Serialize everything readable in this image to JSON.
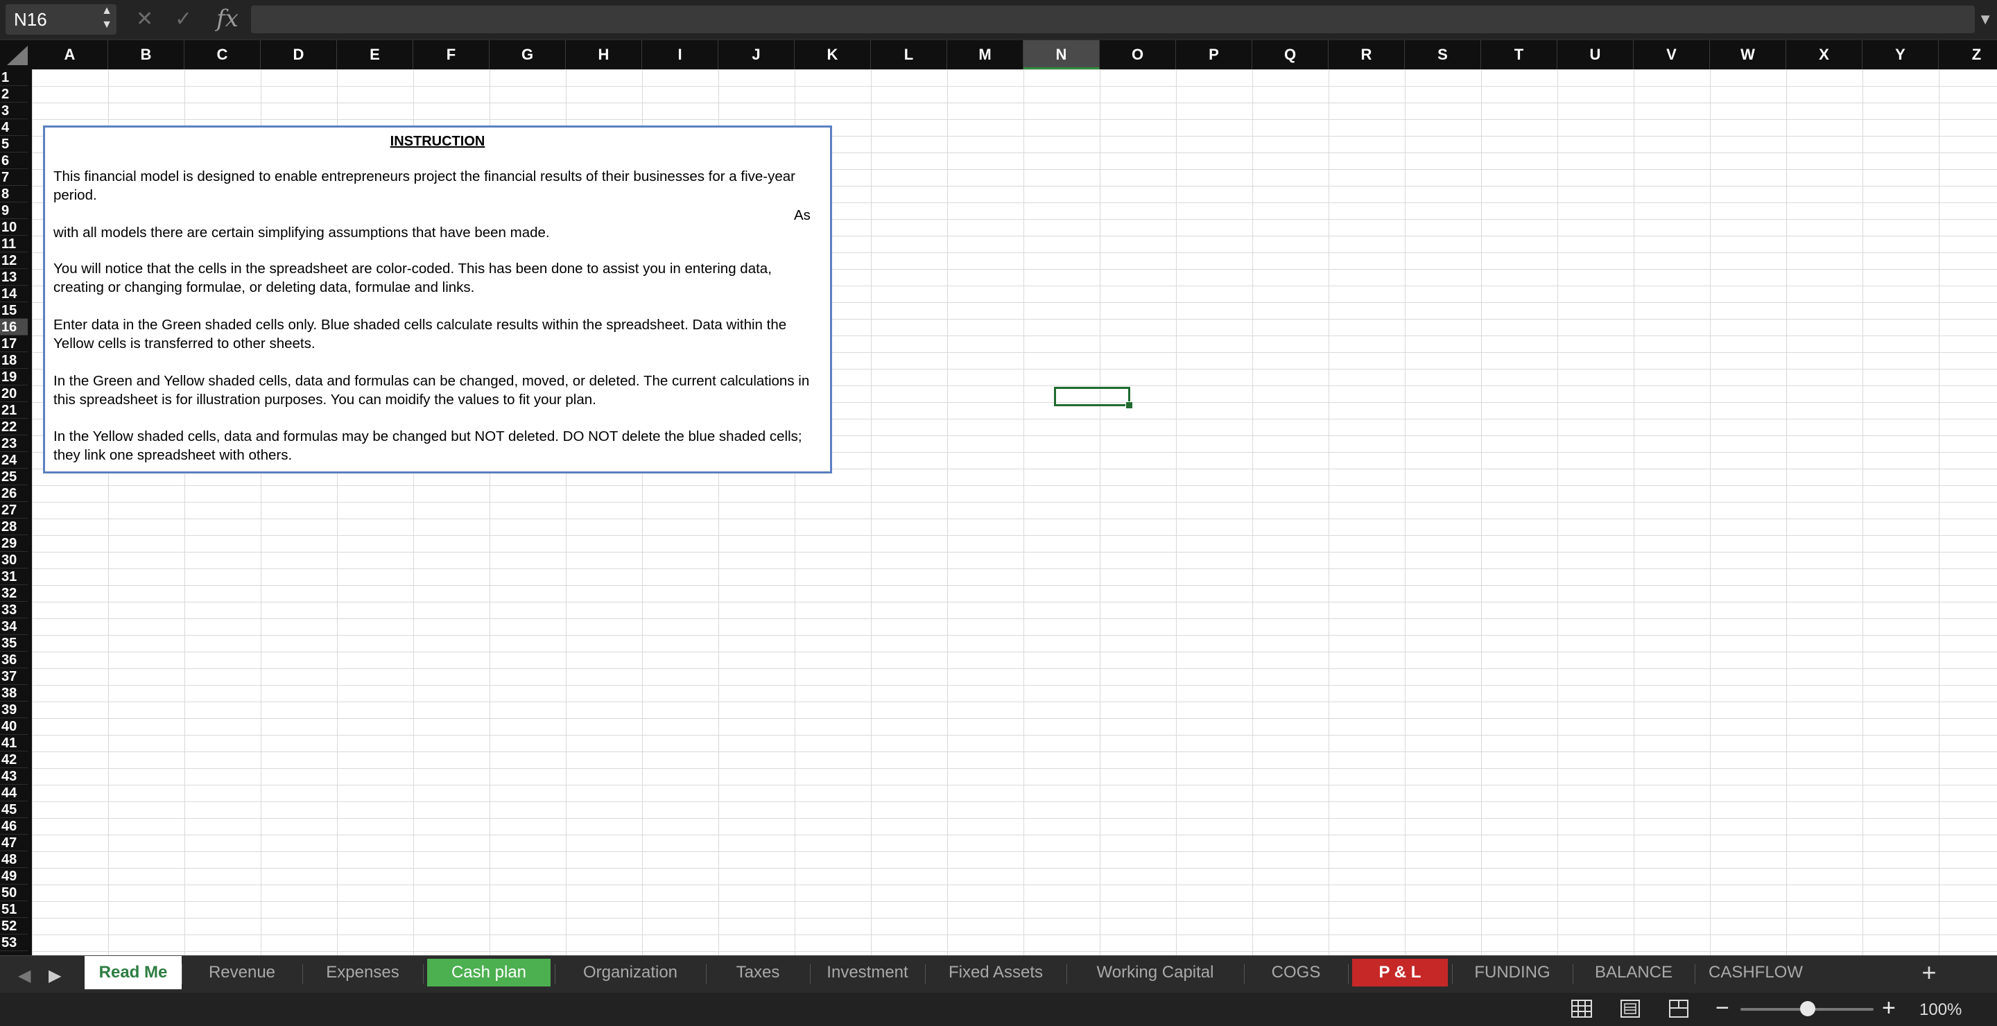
{
  "formula_bar": {
    "cell_ref": "N16",
    "fx_label": "fx",
    "cancel_icon": "x-icon",
    "confirm_icon": "check-icon",
    "formula_value": ""
  },
  "columns": [
    "A",
    "B",
    "C",
    "D",
    "E",
    "F",
    "G",
    "H",
    "I",
    "J",
    "K",
    "L",
    "M",
    "N",
    "O",
    "P",
    "Q",
    "R",
    "S",
    "T",
    "U",
    "V",
    "W",
    "X",
    "Y",
    "Z"
  ],
  "selected_column": "N",
  "rows": [
    "1",
    "2",
    "3",
    "4",
    "5",
    "6",
    "7",
    "8",
    "9",
    "10",
    "11",
    "12",
    "13",
    "14",
    "15",
    "16",
    "17",
    "18",
    "19",
    "20",
    "21",
    "22",
    "23",
    "24",
    "25",
    "26",
    "27",
    "28",
    "29",
    "30",
    "31",
    "32",
    "33",
    "34",
    "35",
    "36",
    "37",
    "38",
    "39",
    "40",
    "41",
    "42",
    "43",
    "44",
    "45",
    "46",
    "47",
    "48",
    "49",
    "50",
    "51",
    "52",
    "53"
  ],
  "selected_row": "16",
  "instruction": {
    "title": "INSTRUCTION",
    "p1": "This financial model is designed to enable entrepreneurs project the financial results of their businesses for a five-year period.",
    "p1_as": "As",
    "p1b": "with all models there are certain simplifying assumptions that have been made.",
    "p2": "You will notice that the cells in the spreadsheet are color-coded. This has been done to assist you in entering data, creating or changing formulae, or deleting data, formulae and links.",
    "p3": "Enter data in the Green shaded cells only. Blue shaded cells calculate results within the spreadsheet. Data within the Yellow cells is transferred to other sheets.",
    "p4": "In the Green and Yellow shaded cells, data and formulas can be changed, moved, or deleted. The current calculations in this spreadsheet is for illustration purposes. You can moidify the values to fit your plan.",
    "p5": "In the Yellow shaded cells, data and formulas may be changed but NOT deleted. DO NOT delete the blue shaded cells; they link one spreadsheet with others."
  },
  "sheet_tabs": [
    {
      "label": "Read Me",
      "active": true,
      "color": "#ffffff"
    },
    {
      "label": "Revenue",
      "active": false,
      "color": ""
    },
    {
      "label": "Expenses",
      "active": false,
      "color": ""
    },
    {
      "label": "Cash plan",
      "active": false,
      "color": "#4caf50"
    },
    {
      "label": "Organization",
      "active": false,
      "color": ""
    },
    {
      "label": "Taxes",
      "active": false,
      "color": ""
    },
    {
      "label": "Investment",
      "active": false,
      "color": ""
    },
    {
      "label": "Fixed Assets",
      "active": false,
      "color": ""
    },
    {
      "label": "Working Capital",
      "active": false,
      "color": ""
    },
    {
      "label": "COGS",
      "active": false,
      "color": ""
    },
    {
      "label": "P & L",
      "active": false,
      "color": "#c62828"
    },
    {
      "label": "FUNDING",
      "active": false,
      "color": ""
    },
    {
      "label": "BALANCE",
      "active": false,
      "color": ""
    },
    {
      "label": "CASHFLOW",
      "active": false,
      "color": ""
    }
  ],
  "add_sheet_label": "+",
  "status_bar": {
    "zoom_level": "100%",
    "zoom_fraction": 0.5
  },
  "colors": {
    "accent_green": "#2e7d42",
    "selection_border": "#1f6b30",
    "textbox_border": "#5b80c0"
  }
}
